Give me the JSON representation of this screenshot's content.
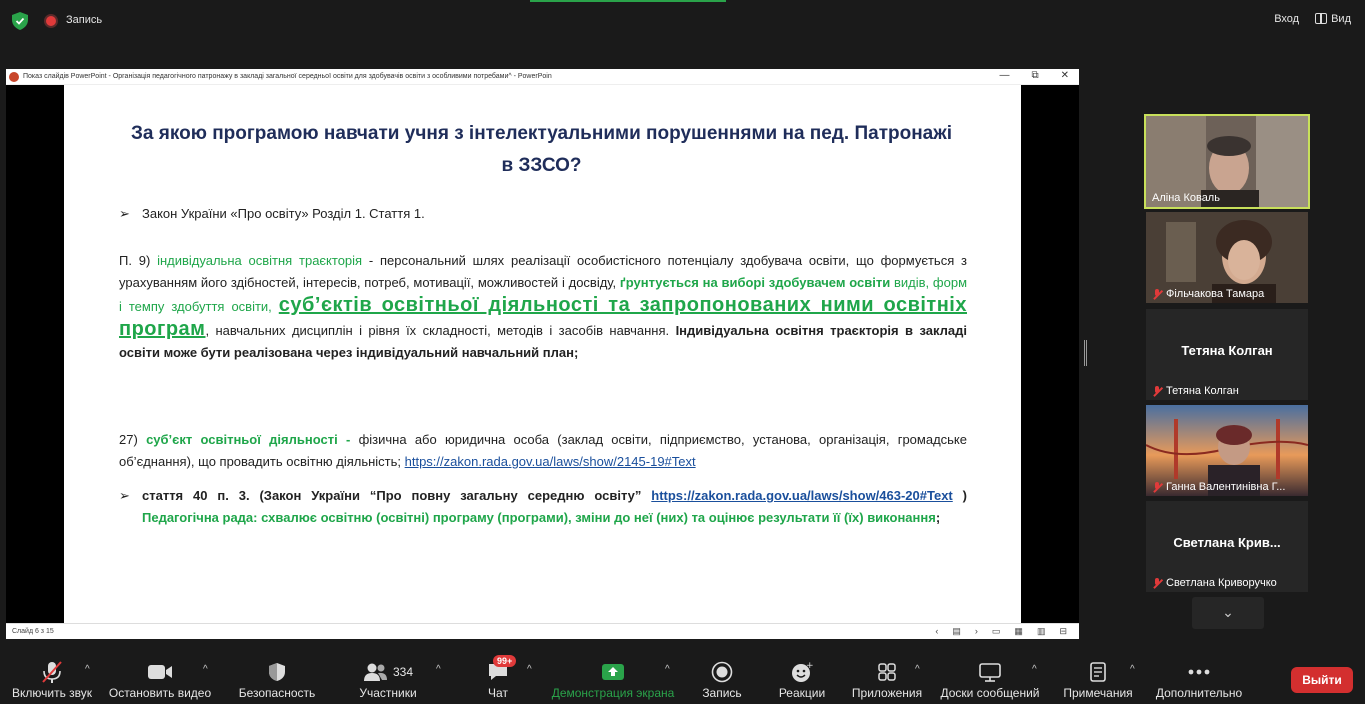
{
  "topbar": {
    "recording_label": "Запись",
    "signin_label": "Вход",
    "view_label": "Вид"
  },
  "ppt": {
    "window_title": "Показ слайдів PowerPoint  -  Організація педагогічного патронажу в закладі загальної середньої освіти для здобувачів освіти з особливими потребами^ - PowerPoin",
    "slide_counter": "Слайд 6 з 15",
    "win_min": "—",
    "win_restore": "⧉",
    "win_close": "✕",
    "nav": {
      "prev": "‹",
      "menu": "▤",
      "next": "›",
      "view1": "▭",
      "view2": "▦",
      "view3": "▥",
      "view4": "⊟"
    }
  },
  "slide": {
    "title": "За якою програмою навчати учня з інтелектуальними порушеннями на пед. Патронажі в ЗЗСО?",
    "bullet_glyph": "➢",
    "law_line": "Закон України «Про освіту» Розділ 1. Стаття 1.",
    "p9_prefix": "П. 9) ",
    "p9_term": "індивідуальна освітня траєкторія",
    "p9_text1": " - персональний шлях реалізації особистісного потенціалу здобувача освіти, що формується з урахуванням його здібностей, інтересів, потреб, мотивації, можливостей і досвіду, ",
    "p9_green_bold1": "ґрунтується на виборі здобувачем освіти",
    "p9_green1": " видів, форм і темпу здобуття освіти, ",
    "p9_big": "суб’єктів освітньої діяльності та запропонованих ними освітніх програм",
    "p9_text2": ", навчальних дисциплін і рівня їх складності, методів і засобів навчання. ",
    "p9_bold": "Індивідуальна освітня траєкторія в закладі освіти може бути реалізована через індивідуальний навчальний план;",
    "p27_prefix": "27) ",
    "p27_term": "суб’єкт освітньої діяльності -",
    "p27_text": " фізична або юридична особа (заклад освіти, підприємство, установа, організація, громадське об’єднання), що провадить освітню діяльність; ",
    "p27_link": "https://zakon.rada.gov.ua/laws/show/2145-19#Text",
    "art40_bold": "стаття 40 п. 3. (Закон України “Про повну загальну середню освіту” ",
    "art40_link": "https://zakon.rada.gov.ua/laws/show/463-20#Text",
    "art40_close": " )",
    "art40_green": "Педагогічна рада: схвалює освітню (освітні) програму (програми), зміни до неї (них) та оцінює результати її (їх) виконання",
    "art40_end": ";"
  },
  "participants": [
    {
      "name": "Аліна Коваль",
      "muted": false,
      "video": true
    },
    {
      "name": "Фільчакова Тамара",
      "muted": true,
      "video": true
    },
    {
      "name": "Тетяна Колган",
      "center": "Тетяна Колган",
      "muted": true,
      "video": false
    },
    {
      "name": "Ганна Валентинівна Г...",
      "muted": true,
      "video": true
    },
    {
      "name": "Светлана Криворучко",
      "center": "Светлана  Крив...",
      "muted": true,
      "video": false
    }
  ],
  "scroll_down": "⌄",
  "toolbar": {
    "mute": "Включить звук",
    "video": "Остановить видео",
    "security": "Безопасность",
    "participants": "Участники",
    "participants_count": "334",
    "chat": "Чат",
    "chat_badge": "99+",
    "share": "Демонстрация экрана",
    "record": "Запись",
    "reactions": "Реакции",
    "apps": "Приложения",
    "whiteboards": "Доски сообщений",
    "notes": "Примечания",
    "more": "Дополнительно",
    "end": "Выйти",
    "caret": "^"
  },
  "colors": {
    "accent_green": "#1fa64a",
    "title_navy": "#1f2d5a",
    "end_red": "#d32f2f",
    "active_speaker_border": "#c8e05a"
  }
}
